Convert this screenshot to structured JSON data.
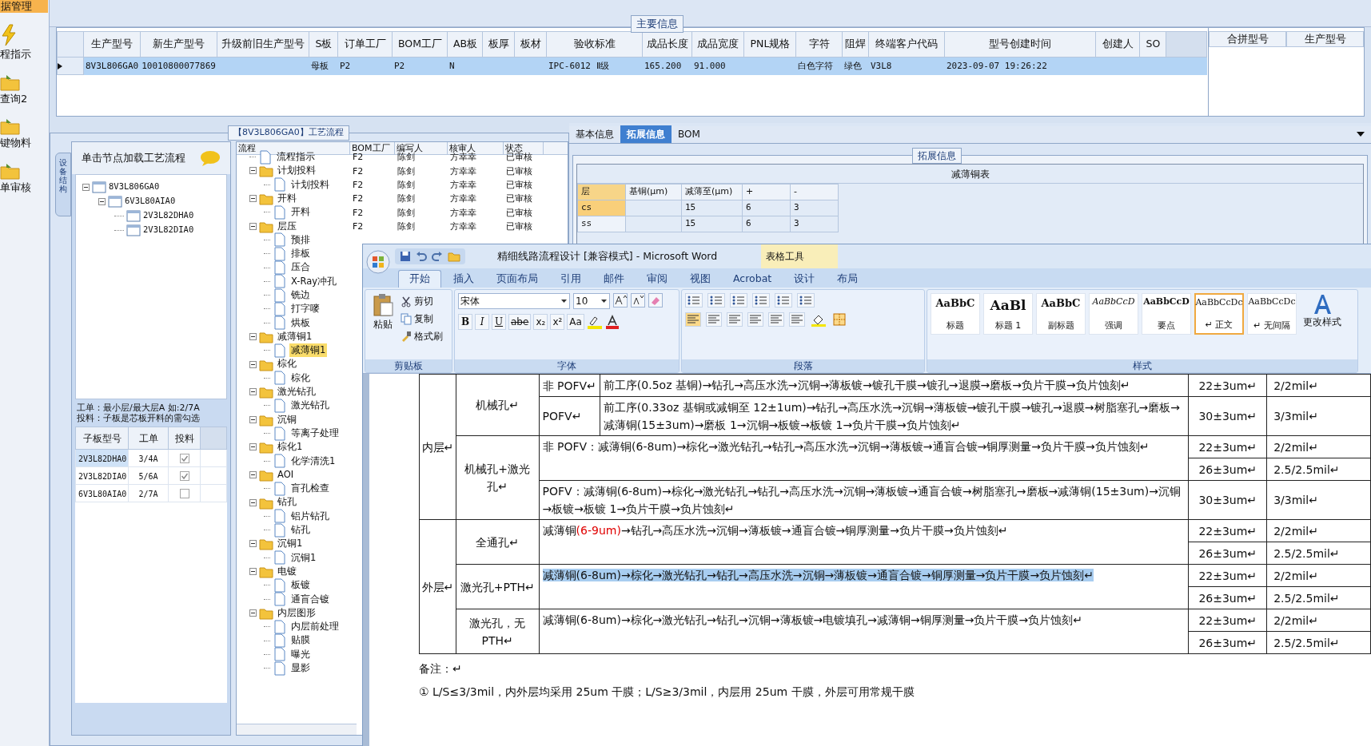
{
  "sidebar": {
    "items": [
      {
        "label": "据管理",
        "selected": true
      },
      {
        "label": "程指示",
        "selected": false
      },
      {
        "label": "查询2",
        "selected": false
      },
      {
        "label": "键物料",
        "selected": false
      },
      {
        "label": "单审核",
        "selected": false
      }
    ]
  },
  "main_info": {
    "title": "主要信息",
    "columns": [
      "生产型号",
      "新生产型号",
      "升级前旧生产型号",
      "S板",
      "订单工厂",
      "BOM工厂",
      "AB板",
      "板厚",
      "板材",
      "验收标准",
      "成品长度",
      "成品宽度",
      "PNL规格",
      "字符",
      "阻焊",
      "终端客户代码",
      "型号创建时间",
      "创建人",
      "SO"
    ],
    "rows": [
      {
        "selected": true,
        "cells": [
          "8V3L806GA0",
          "10010800077869",
          null,
          "母板",
          "P2",
          "P2",
          "N",
          null,
          null,
          "IPC-6012 Ⅱ级",
          "165.200",
          "91.000",
          null,
          "白色字符",
          "绿色",
          "V3L8",
          "2023-09-07 19:26:22",
          null,
          null
        ]
      }
    ]
  },
  "merge_panel": {
    "columns": [
      "合拼型号",
      "生产型号"
    ]
  },
  "process_panel": {
    "title": "【8V3L806GA0】工艺流程",
    "side_tab": "设备结构",
    "hint": "单击节点加载工艺流程",
    "tree": [
      {
        "label": "8V3L806GA0",
        "expanded": true,
        "children": [
          {
            "label": "6V3L80AIA0",
            "expanded": true,
            "children": [
              {
                "label": "2V3L82DHA0"
              },
              {
                "label": "2V3L82DIA0"
              }
            ]
          }
        ]
      }
    ],
    "notes": [
      "工单：最小层/最大层A 如:2/7A",
      "投料：子板是芯板开料的需勾选"
    ],
    "sub_boards": {
      "columns": [
        "子板型号",
        "工单",
        "投料"
      ],
      "rows": [
        {
          "model": "2V3L82DHA0",
          "order": "3/4A",
          "feed": true,
          "selected": true
        },
        {
          "model": "2V3L82DIA0",
          "order": "5/6A",
          "feed": true,
          "selected": false
        },
        {
          "model": "6V3L80AIA0",
          "order": "2/7A",
          "feed": false,
          "selected": false
        }
      ]
    }
  },
  "flow": {
    "columns": [
      "流程",
      "BOM工厂",
      "编写人",
      "核审人",
      "状态"
    ],
    "tree": [
      {
        "label": "流程指示",
        "values": [
          "F2",
          "陈剑",
          "方幸幸",
          "已审核"
        ]
      },
      {
        "label": "计划投料",
        "expanded": true,
        "values": [
          "F2",
          "陈剑",
          "方幸幸",
          "已审核"
        ],
        "children": [
          {
            "label": "计划投料",
            "values": [
              "F2",
              "陈剑",
              "方幸幸",
              "已审核"
            ]
          }
        ]
      },
      {
        "label": "开料",
        "expanded": true,
        "values": [
          "F2",
          "陈剑",
          "方幸幸",
          "已审核"
        ],
        "children": [
          {
            "label": "开料",
            "values": [
              "F2",
              "陈剑",
              "方幸幸",
              "已审核"
            ]
          }
        ]
      },
      {
        "label": "层压",
        "expanded": true,
        "values": [
          "F2",
          "陈剑",
          "方幸幸",
          "已审核"
        ],
        "children": [
          {
            "label": "预排"
          },
          {
            "label": "排板"
          },
          {
            "label": "压合"
          },
          {
            "label": "X-Ray冲孔"
          },
          {
            "label": "铣边"
          },
          {
            "label": "打字嘜"
          },
          {
            "label": "烘板"
          }
        ]
      },
      {
        "label": "减薄铜1",
        "expanded": true,
        "children": [
          {
            "label": "减薄铜1",
            "selected": true
          }
        ]
      },
      {
        "label": "棕化",
        "expanded": true,
        "children": [
          {
            "label": "棕化"
          }
        ]
      },
      {
        "label": "激光钻孔",
        "expanded": true,
        "children": [
          {
            "label": "激光钻孔"
          }
        ]
      },
      {
        "label": "沉铜",
        "expanded": true,
        "children": [
          {
            "label": "等离子处理"
          }
        ]
      },
      {
        "label": "棕化1",
        "expanded": true,
        "children": [
          {
            "label": "化学清洗1"
          }
        ]
      },
      {
        "label": "AOI",
        "expanded": true,
        "children": [
          {
            "label": "盲孔检查"
          }
        ]
      },
      {
        "label": "钻孔",
        "expanded": true,
        "children": [
          {
            "label": "铝片钻孔"
          },
          {
            "label": "钻孔"
          }
        ]
      },
      {
        "label": "沉铜1",
        "expanded": true,
        "children": [
          {
            "label": "沉铜1"
          }
        ]
      },
      {
        "label": "电镀",
        "expanded": true,
        "children": [
          {
            "label": "板镀"
          },
          {
            "label": "通盲合镀"
          }
        ]
      },
      {
        "label": "内层图形",
        "expanded": true,
        "children": [
          {
            "label": "内层前处理"
          },
          {
            "label": "贴膜"
          },
          {
            "label": "曝光"
          },
          {
            "label": "显影"
          }
        ]
      }
    ]
  },
  "detail": {
    "tabs": [
      {
        "label": "基本信息",
        "selected": false
      },
      {
        "label": "拓展信息",
        "selected": true
      },
      {
        "label": "BOM",
        "selected": false
      }
    ],
    "group": "拓展信息",
    "table_title": "减薄铜表",
    "columns": [
      "层",
      "基铜(μm)",
      "减薄至(μm)",
      "+",
      "-"
    ],
    "rows": [
      {
        "layer": "cs",
        "target": "15",
        "plus": "6",
        "minus": "3",
        "selected": true
      },
      {
        "layer": "ss",
        "target": "15",
        "plus": "6",
        "minus": "3",
        "selected": false
      }
    ]
  },
  "word": {
    "title": "精细线路流程设计 [兼容模式] - Microsoft Word",
    "context_tab": "表格工具",
    "tabs": [
      {
        "label": "开始",
        "selected": true
      },
      {
        "label": "插入",
        "selected": false
      },
      {
        "label": "页面布局",
        "selected": false
      },
      {
        "label": "引用",
        "selected": false
      },
      {
        "label": "邮件",
        "selected": false
      },
      {
        "label": "审阅",
        "selected": false
      },
      {
        "label": "视图",
        "selected": false
      },
      {
        "label": "Acrobat",
        "selected": false
      },
      {
        "label": "设计",
        "selected": false
      },
      {
        "label": "布局",
        "selected": false
      }
    ],
    "clipboard": {
      "group": "剪贴板",
      "paste": "粘贴",
      "items": [
        "剪切",
        "复制",
        "格式刷"
      ]
    },
    "font": {
      "group": "字体",
      "name": "宋体",
      "size": "10",
      "keys": [
        "B",
        "I",
        "U",
        "abe",
        "x₂",
        "x²",
        "Aa"
      ]
    },
    "paragraph": {
      "group": "段落"
    },
    "styles": {
      "group": "样式",
      "change": "更改样式",
      "items": [
        {
          "sample": "AaBbC",
          "label": "标题",
          "kind": "title",
          "selected": false
        },
        {
          "sample": "AaBl",
          "label": "标题 1",
          "kind": "heading",
          "selected": false
        },
        {
          "sample": "AaBbC",
          "label": "副标题",
          "kind": "title",
          "selected": false
        },
        {
          "sample": "AaBbCcD",
          "label": "强调",
          "kind": "emphasis",
          "selected": false
        },
        {
          "sample": "AaBbCcD",
          "label": "要点",
          "kind": "strong",
          "selected": false
        },
        {
          "sample": "AaBbCcDc",
          "label": "↵ 正文",
          "kind": "normal",
          "selected": true
        },
        {
          "sample": "AaBbCcDc",
          "label": "↵ 无间隔",
          "kind": "normal",
          "selected": false
        }
      ]
    }
  },
  "doc": {
    "sections": [
      {
        "layer": "内层↵",
        "groups": [
          {
            "hole": "机械孔↵",
            "lines": [
              {
                "tag": "非 POFV↵",
                "segments": [
                  {
                    "text": "前工序(0.5oz 基铜)→钻孔→高压水洗→沉铜→薄板镀→镀孔干膜→镀孔→退膜→磨板→负片干膜→负片蚀刻↵"
                  }
                ],
                "specs": [
                  {
                    "thickness": "22±3um↵",
                    "mil": "2/2mil↵"
                  }
                ]
              },
              {
                "tag": "POFV↵",
                "segments": [
                  {
                    "text": "前工序(0.33oz 基铜或减铜至 12±1um)→钻孔→高压水洗→沉铜→薄板镀→镀孔干膜→镀孔→退膜→树脂塞孔→磨板→减薄铜(15±3um)→磨板 1→沉铜→板镀→板镀 1→负片干膜→负片蚀刻↵"
                  }
                ],
                "specs": [
                  {
                    "thickness": "30±3um↵",
                    "mil": "3/3mil↵"
                  }
                ]
              }
            ]
          },
          {
            "hole": "机械孔+激光孔↵",
            "lines": [
              {
                "segments": [
                  {
                    "text": "非 POFV：减薄铜(6-8um)→棕化→激光钻孔→钻孔→高压水洗→沉铜→薄板镀→通盲合镀→铜厚测量→负片干膜→负片蚀刻↵"
                  }
                ],
                "specs": [
                  {
                    "thickness": "22±3um↵",
                    "mil": "2/2mil↵"
                  },
                  {
                    "thickness": "26±3um↵",
                    "mil": "2.5/2.5mil↵"
                  }
                ]
              },
              {
                "segments": [
                  {
                    "text": "POFV：减薄铜(6-8um)→棕化→激光钻孔→钻孔→高压水洗→沉铜→薄板镀→通盲合镀→树脂塞孔→磨板→减薄铜(15±3um)→沉铜→板镀→板镀 1→负片干膜→负片蚀刻↵"
                  }
                ],
                "specs": [
                  {
                    "thickness": "30±3um↵",
                    "mil": "3/3mil↵"
                  }
                ]
              }
            ]
          }
        ]
      },
      {
        "layer": "外层↵",
        "groups": [
          {
            "hole": "全通孔↵",
            "lines": [
              {
                "segments": [
                  {
                    "text": "减薄铜"
                  },
                  {
                    "text": "(6-9um)",
                    "color": "#e00000"
                  },
                  {
                    "text": "→钻孔→高压水洗→沉铜→薄板镀→通盲合镀→铜厚测量→负片干膜→负片蚀刻↵"
                  }
                ],
                "specs": [
                  {
                    "thickness": "22±3um↵",
                    "mil": "2/2mil↵"
                  },
                  {
                    "thickness": "26±3um↵",
                    "mil": "2.5/2.5mil↵"
                  }
                ]
              }
            ]
          },
          {
            "hole": "激光孔+PTH↵",
            "lines": [
              {
                "selected": true,
                "segments": [
                  {
                    "text": "减薄铜(6-8um)→棕化→激光钻孔→钻孔→高压水洗→沉铜→薄板镀→通盲合镀→铜厚测量→负片干膜→负片蚀刻↵"
                  }
                ],
                "specs": [
                  {
                    "thickness": "22±3um↵",
                    "mil": "2/2mil↵"
                  },
                  {
                    "thickness": "26±3um↵",
                    "mil": "2.5/2.5mil↵"
                  }
                ]
              }
            ]
          },
          {
            "hole": "激光孔，无 PTH↵",
            "lines": [
              {
                "segments": [
                  {
                    "text": "减薄铜(6-8um)→棕化→激光钻孔→钻孔→沉铜→薄板镀→电镀填孔→减薄铜→铜厚测量→负片干膜→负片蚀刻↵"
                  }
                ],
                "specs": [
                  {
                    "thickness": "22±3um↵",
                    "mil": "2/2mil↵"
                  },
                  {
                    "thickness": "26±3um↵",
                    "mil": "2.5/2.5mil↵"
                  }
                ]
              }
            ]
          }
        ]
      }
    ],
    "remark": "备注：↵",
    "note": "① L/S≤3/3mil，内外层均采用 25um 干膜；L/S≥3/3mil，内层用 25um 干膜，外层可用常规干膜"
  }
}
